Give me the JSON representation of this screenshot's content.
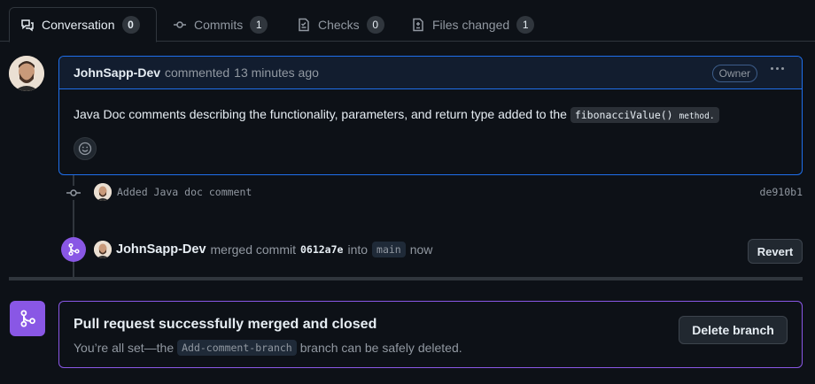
{
  "tabs": [
    {
      "label": "Conversation",
      "count": "0",
      "icon": "comment-discussion-icon"
    },
    {
      "label": "Commits",
      "count": "1",
      "icon": "git-commit-icon"
    },
    {
      "label": "Checks",
      "count": "0",
      "icon": "checklist-icon"
    },
    {
      "label": "Files changed",
      "count": "1",
      "icon": "file-diff-icon"
    }
  ],
  "comment": {
    "author": "JohnSapp-Dev",
    "action": "commented",
    "time": "13 minutes ago",
    "badge": "Owner",
    "body_text": "Java Doc comments describing the functionality, parameters, and return type added to the",
    "code_method": "fibonacciValue()",
    "code_suffix": "method."
  },
  "commit": {
    "message": "Added Java doc comment",
    "sha": "de910b1"
  },
  "merge_event": {
    "author": "JohnSapp-Dev",
    "action": "merged commit",
    "hash": "0612a7e",
    "into": "into",
    "branch": "main",
    "time": "now",
    "revert_label": "Revert"
  },
  "merged_status": {
    "title": "Pull request successfully merged and closed",
    "sub_prefix": "You’re all set—the",
    "branch": "Add-comment-branch",
    "sub_suffix": "branch can be safely deleted.",
    "delete_label": "Delete branch"
  },
  "colors": {
    "accent_blue": "#1f6feb",
    "merged_purple": "#8957e5",
    "background": "#0d1117"
  }
}
